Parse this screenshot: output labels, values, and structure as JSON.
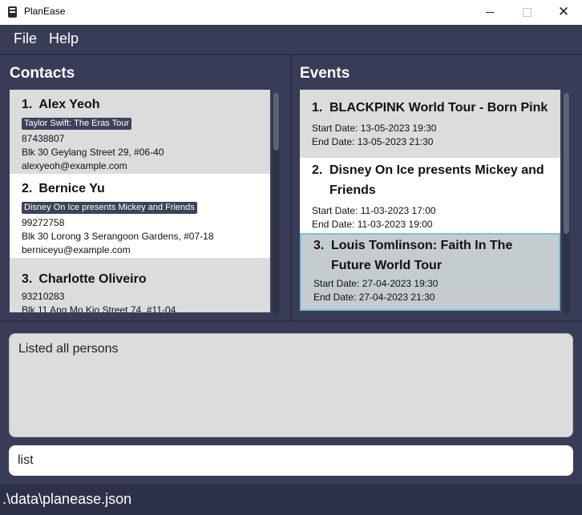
{
  "window": {
    "title": "PlanEase",
    "icon": "notebook-icon"
  },
  "menu": {
    "file": "File",
    "help": "Help"
  },
  "contacts": {
    "title": "Contacts",
    "persons": [
      {
        "index": "1.",
        "name": "Alex Yeoh",
        "tag": "Taylor Swift: The Eras Tour",
        "phone": "87438807",
        "address": "Blk 30 Geylang Street 29, #06-40",
        "email": "alexyeoh@example.com"
      },
      {
        "index": "2.",
        "name": "Bernice Yu",
        "tag": "Disney On Ice presents Mickey and Friends",
        "phone": "99272758",
        "address": "Blk 30 Lorong 3 Serangoon Gardens, #07-18",
        "email": "berniceyu@example.com"
      },
      {
        "index": "3.",
        "name": "Charlotte Oliveiro",
        "phone": "93210283",
        "address": "Blk 11 Ang Mo Kio Street 74, #11-04"
      }
    ]
  },
  "events": {
    "title": "Events",
    "items": [
      {
        "index": "1.",
        "name": "BLACKPINK World Tour - Born Pink",
        "start": "Start Date: 13-05-2023 19:30",
        "end": "End Date: 13-05-2023 21:30"
      },
      {
        "index": "2.",
        "name": "Disney On Ice presents Mickey and Friends",
        "start": "Start Date: 11-03-2023 17:00",
        "end": "End Date: 11-03-2023 19:00"
      },
      {
        "index": "3.",
        "name": "Louis Tomlinson: Faith In The Future World Tour",
        "start": "Start Date: 27-04-2023 19:30",
        "end": "End Date: 27-04-2023 21:30"
      }
    ]
  },
  "result": {
    "text": "Listed all persons"
  },
  "command": {
    "value": "list"
  },
  "status": {
    "path": ".\\data\\planease.json"
  },
  "colors": {
    "background": "#383c57",
    "tag": "#3e4258",
    "selected": "#c4cccf",
    "selected_border": "#7ec0d3"
  }
}
